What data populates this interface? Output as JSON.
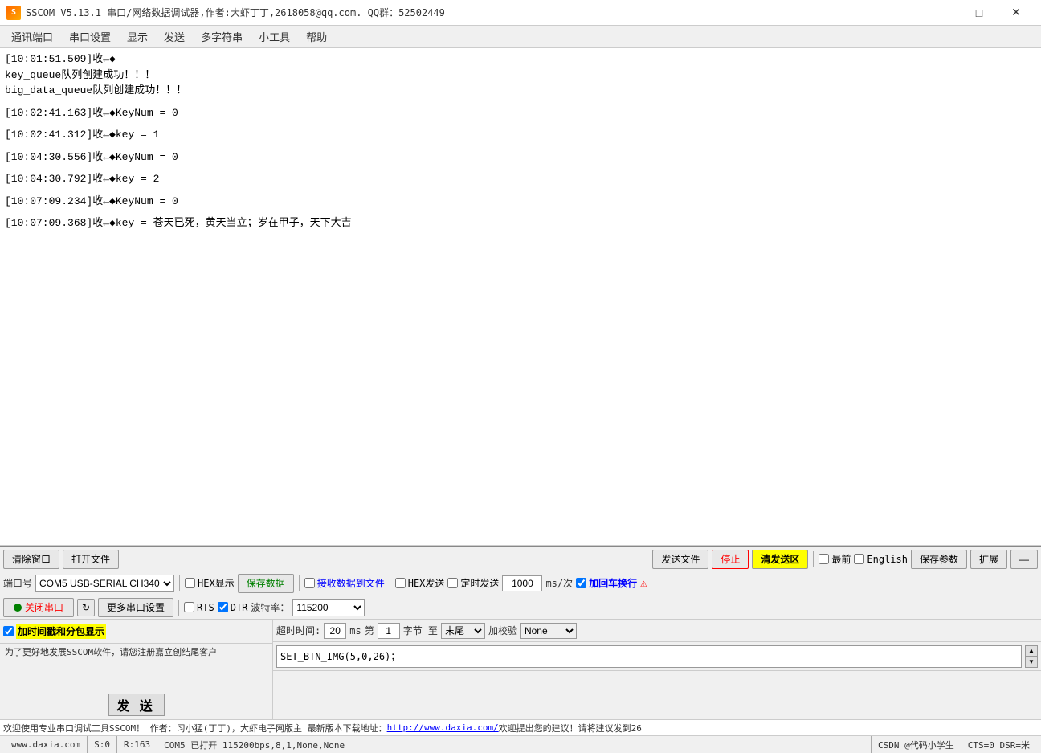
{
  "titleBar": {
    "icon": "S",
    "title": "SSCOM V5.13.1 串口/网络数据调试器,作者:大虾丁丁,2618058@qq.com. QQ群：52502449"
  },
  "menuBar": {
    "items": [
      "通讯端口",
      "串口设置",
      "显示",
      "发送",
      "多字符串",
      "小工具",
      "帮助"
    ]
  },
  "outputArea": {
    "lines": [
      "[10:01:51.509]收←◆",
      "key_queue队列创建成功！！！",
      "big_data_queue队列创建成功！！！",
      "",
      "[10:02:41.163]收←◆KeyNum = 0",
      "",
      "[10:02:41.312]收←◆key = 1",
      "",
      "[10:04:30.556]收←◆KeyNum = 0",
      "",
      "[10:04:30.792]收←◆key = 2",
      "",
      "[10:07:09.234]收←◆KeyNum = 0",
      "",
      "[10:07:09.368]收←◆key = 苍天已死，黄天当立；岁在甲子，天下大吉"
    ]
  },
  "bottomPanel": {
    "tl1": {
      "clearBtn": "清除窗口",
      "openFileBtn": "打开文件",
      "sendFileBtn": "发送文件",
      "stopBtn": "停止",
      "clearSendBtn": "清发送区",
      "checkLast": "最前",
      "checkEnglish": "English",
      "saveParamsBtn": "保存参数",
      "expandBtn": "扩展",
      "minusBtn": "—"
    },
    "tl2": {
      "portLabel": "端口号",
      "portValue": "COM5 USB-SERIAL CH340",
      "hexDisplayCheck": "HEX显示",
      "saveDataBtn": "保存数据",
      "recvToFileCheck": "接收数据到文件",
      "hexSendCheck": "HEX发送",
      "timedSendCheck": "定时发送",
      "msValue": "1000",
      "msUnit": "ms/次",
      "addCRLFCheck": "加回车换行"
    },
    "tl3": {
      "openCloseBtn": "关闭串口",
      "refreshBtn": "↻",
      "moreSettingsBtn": "更多串口设置",
      "rtsCheck": "RTS",
      "dtrCheck": "DTR",
      "baudLabel": "波特率：",
      "baudValue": "115200"
    },
    "tl4": {
      "timestampCheck": "加时间戳和分包显示",
      "timeoutLabel": "超时时间:",
      "timeoutValue": "20",
      "timeoutUnit": "ms",
      "byteLabel": "第",
      "byteValue": "1",
      "byteUnit": "字节 至",
      "byteEndValue": "末尾",
      "checksumLabel": "加校验",
      "checksumValue": "None"
    },
    "tl5": {
      "sendText": "SET_BTN_IMG(5,0,26)；"
    },
    "sendBtn": "发 送"
  },
  "infoBar": {
    "text": "欢迎使用专业串口调试工具SSCOM！  作者：习小猛(丁丁)，大虾电子网版主  最新版本下载地址：",
    "link": "http://www.daxia.com/",
    "afterLink": " 欢迎提出您的建议！请将建议发到26"
  },
  "statusBar": {
    "website": "www.daxia.com",
    "s": "S:0",
    "r": "R:163",
    "com": "COM5 已打开  115200bps,8,1,None,None",
    "right": "CSDN @代码小学生",
    "cts": "CTS=0  DSR=米"
  },
  "promoBanner": {
    "text": "为了更好地发展SSCOM软件，请您注册嘉立创结尾客户"
  }
}
